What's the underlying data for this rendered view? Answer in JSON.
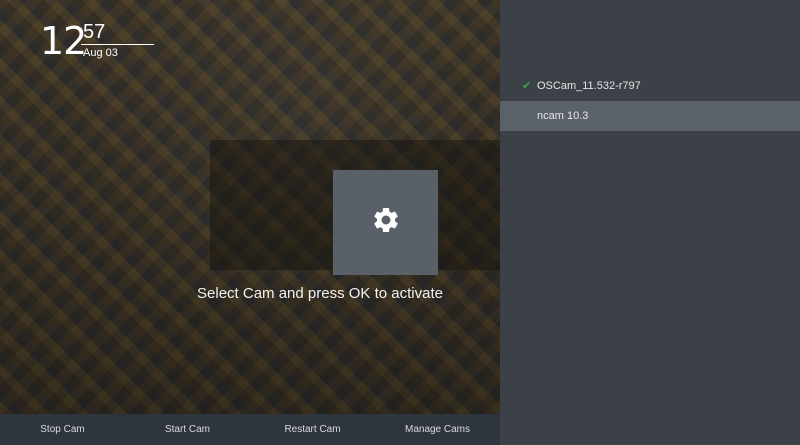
{
  "clock": {
    "hour": "12",
    "minute": "57",
    "date": "Aug 03"
  },
  "dialog": {
    "icon": "gear-icon",
    "message": "Select Cam and press OK to activate"
  },
  "bottom_bar": {
    "buttons": [
      {
        "label": "Stop Cam"
      },
      {
        "label": "Start Cam"
      },
      {
        "label": "Restart Cam"
      },
      {
        "label": "Manage Cams"
      }
    ]
  },
  "cam_list": {
    "items": [
      {
        "label": "OSCam_11.532-r797",
        "active": true,
        "check_icon": "checkmark-icon"
      },
      {
        "label": "ncam 10.3",
        "active": false,
        "selected": true
      }
    ]
  },
  "colors": {
    "active_check": "#3aa64a",
    "selection": "#5b6168",
    "panel": "#3c4148"
  }
}
